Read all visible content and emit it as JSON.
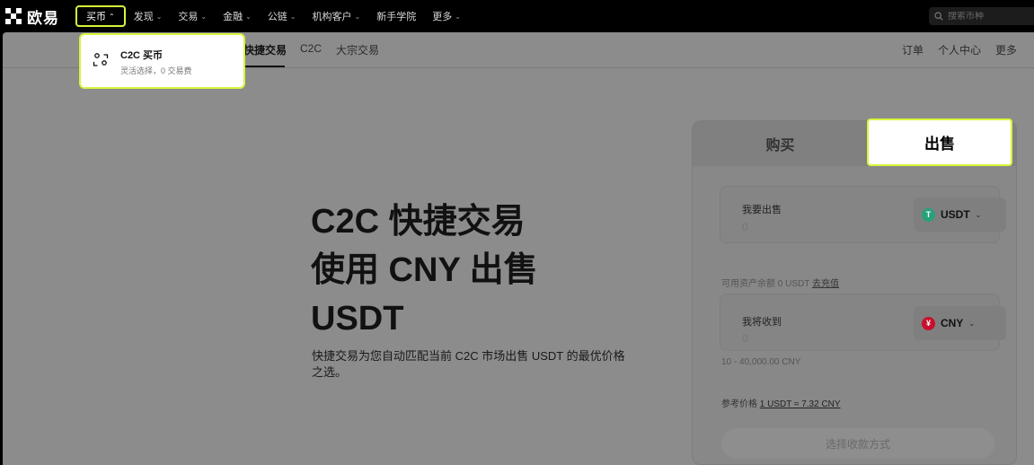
{
  "brand": {
    "name": "欧易"
  },
  "nav": {
    "items": [
      {
        "label": "买币",
        "chevron": "^",
        "active": true
      },
      {
        "label": "发现",
        "chevron": "v"
      },
      {
        "label": "交易",
        "chevron": "v"
      },
      {
        "label": "金融",
        "chevron": "v"
      },
      {
        "label": "公链",
        "chevron": "v"
      },
      {
        "label": "机构客户",
        "chevron": "v"
      },
      {
        "label": "新手学院"
      },
      {
        "label": "更多",
        "chevron": "v"
      }
    ],
    "search_placeholder": "搜索币种"
  },
  "dropdown": {
    "title": "C2C 买币",
    "subtitle": "灵活选择，0 交易费"
  },
  "subnav": {
    "tabs": [
      "快捷交易",
      "C2C",
      "大宗交易"
    ],
    "right": [
      "订单",
      "个人中心",
      "更多"
    ]
  },
  "hero": {
    "line1": "C2C 快捷交易",
    "line2": "使用 CNY 出售",
    "line3": "USDT",
    "description": "快捷交易为您自动匹配当前 C2C 市场出售 USDT 的最优价格之选。"
  },
  "card": {
    "buy_tab": "购买",
    "sell_tab": "出售",
    "sell_field": {
      "label": "我要出售",
      "placeholder": "0",
      "coin": "USDT",
      "coin_color": "#26A17B",
      "coin_symbol": "T"
    },
    "balance_hint": "可用资产余额 0 USDT",
    "balance_link": "去充值",
    "receive_field": {
      "label": "我将收到",
      "placeholder": "0",
      "coin": "CNY",
      "coin_color": "#C8102E",
      "coin_symbol": "¥"
    },
    "limit_hint": "10 - 40,000.00 CNY",
    "rate_label": "参考价格",
    "rate_value": "1 USDT ≈ 7.32 CNY",
    "submit": "选择收款方式"
  },
  "colors": {
    "highlight": "#d6f53a"
  }
}
